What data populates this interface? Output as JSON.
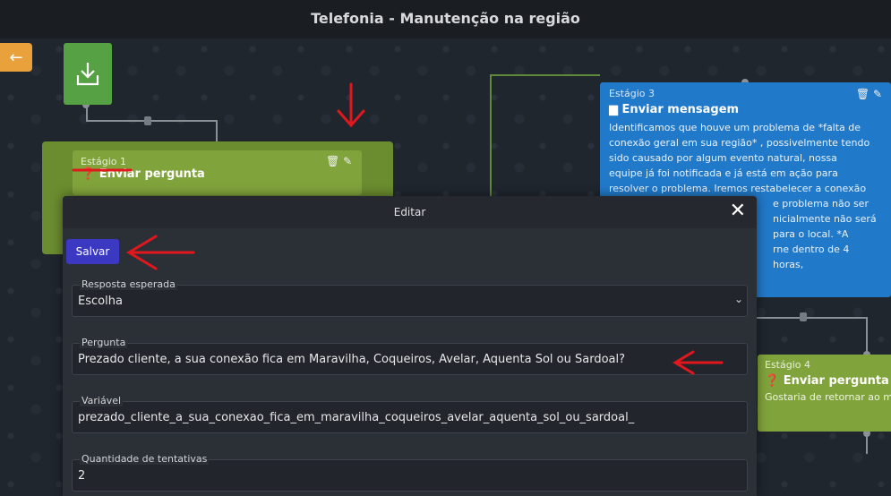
{
  "header": {
    "title": "Telefonia - Manutenção na região"
  },
  "canvas": {
    "back_icon": "arrow-left-icon",
    "start_icon": "download-icon"
  },
  "stage1": {
    "label": "Estágio 1",
    "type": "Enviar pergunta",
    "icon": "question-circle-icon"
  },
  "stage3": {
    "label": "Estágio 3",
    "type": "Enviar mensagem",
    "icon": "message-icon",
    "lines": [
      "Identificamos que houve um problema de *falta de",
      "conexão geral em sua região* , possivelmente tendo",
      "sido causado por algum evento natural, nossa",
      "equipe já foi notificada e já está em ação para",
      "resolver o problema. Iremos restabelecer a conexão",
      "e problema não ser",
      "nicialmente não será",
      "para o local. *A",
      "rne dentro de 4 horas,"
    ]
  },
  "stage4": {
    "label": "Estágio 4",
    "type": "Enviar pergunta",
    "text": "Gostaria de retornar ao me",
    "icon": "question-circle-icon"
  },
  "modal": {
    "title": "Editar",
    "save_label": "Salvar",
    "fields": {
      "resposta": {
        "label": "Resposta esperada",
        "value": "Escolha"
      },
      "pergunta": {
        "label": "Pergunta",
        "value": "Prezado cliente, a sua conexão fica em Maravilha, Coqueiros, Avelar, Aquenta Sol ou Sardoal?"
      },
      "variavel": {
        "label": "Variável",
        "value": "prezado_cliente_a_sua_conexao_fica_em_maravilha_coqueiros_avelar_aquenta_sol_ou_sardoal_"
      },
      "tentativas": {
        "label": "Quantidade de tentativas",
        "value": "2"
      }
    }
  },
  "colors": {
    "accent_green": "#80a33b",
    "accent_blue": "#2179c9",
    "save_button": "#3b38c2",
    "annotation_red": "#e0181e"
  }
}
